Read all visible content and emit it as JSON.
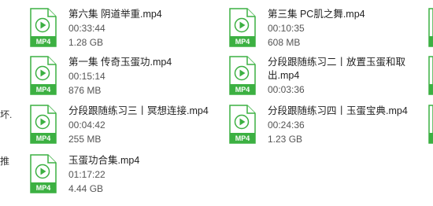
{
  "left_fragments": [
    "坏.",
    "推"
  ],
  "mp4_badge": "MP4",
  "icon": {
    "name": "video-file-icon",
    "color": "#3cb042"
  },
  "files": [
    {
      "name": "第六集 阴道举重.mp4",
      "duration": "00:33:44",
      "size": "1.28 GB"
    },
    {
      "name": "第三集 PC肌之舞.mp4",
      "duration": "00:10:35",
      "size": "608 MB"
    },
    {
      "name": "第一集 传奇玉蛋功.mp4",
      "duration": "00:15:14",
      "size": "876 MB"
    },
    {
      "name": "分段跟随练习二丨放置玉蛋和取出.mp4",
      "duration": "00:03:36",
      "size": ""
    },
    {
      "name": "分段跟随练习三丨冥想连接.mp4",
      "duration": "00:04:42",
      "size": "255 MB"
    },
    {
      "name": "分段跟随练习四丨玉蛋宝典.mp4",
      "duration": "00:24:36",
      "size": "1.23 GB"
    },
    {
      "name": "玉蛋功合集.mp4",
      "duration": "01:17:22",
      "size": "4.44 GB"
    }
  ]
}
